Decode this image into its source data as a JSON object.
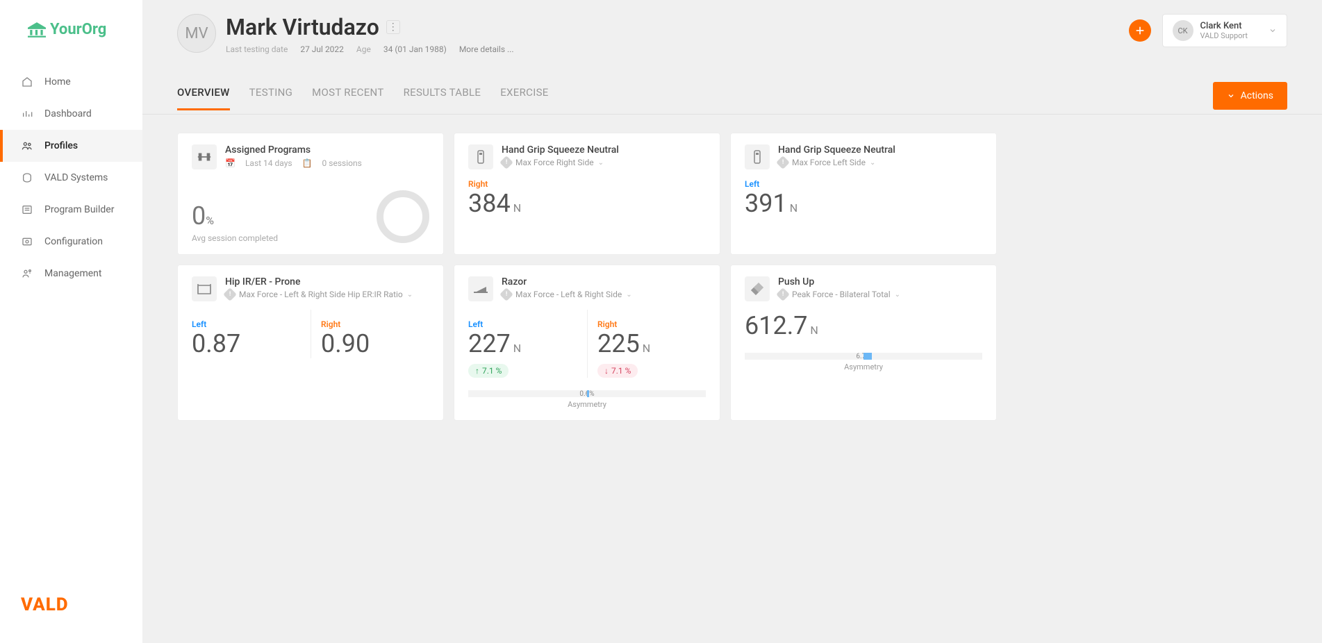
{
  "brand": {
    "name": "YourOrg",
    "footer": "VALD"
  },
  "nav": {
    "home": "Home",
    "dashboard": "Dashboard",
    "profiles": "Profiles",
    "vald_systems": "VALD Systems",
    "program_builder": "Program Builder",
    "configuration": "Configuration",
    "management": "Management"
  },
  "profile": {
    "initials": "MV",
    "name": "Mark Virtudazo",
    "last_testing_label": "Last testing date",
    "last_testing_value": "27 Jul 2022",
    "age_label": "Age",
    "age_value": "34 (01 Jan 1988)",
    "more_details": "More details ..."
  },
  "user": {
    "initials": "CK",
    "name": "Clark Kent",
    "role": "VALD Support"
  },
  "tabs": {
    "overview": "OVERVIEW",
    "testing": "TESTING",
    "most_recent": "MOST RECENT",
    "results_table": "RESULTS TABLE",
    "exercise": "EXERCISE"
  },
  "actions_label": "Actions",
  "cards": {
    "assigned": {
      "title": "Assigned Programs",
      "period": "Last 14 days",
      "sessions": "0 sessions",
      "pct": "0",
      "pct_unit": "%",
      "caption": "Avg session completed"
    },
    "grip_right": {
      "title": "Hand Grip Squeeze Neutral",
      "metric": "Max Force Right Side",
      "side": "Right",
      "value": "384",
      "unit": "N"
    },
    "grip_left": {
      "title": "Hand Grip Squeeze Neutral",
      "metric": "Max Force Left Side",
      "side": "Left",
      "value": "391",
      "unit": "N"
    },
    "hip": {
      "title": "Hip IR/ER - Prone",
      "metric": "Max Force - Left & Right Side Hip ER:IR Ratio",
      "left_label": "Left",
      "left_value": "0.87",
      "right_label": "Right",
      "right_value": "0.90"
    },
    "razor": {
      "title": "Razor",
      "metric": "Max Force - Left & Right Side",
      "left_label": "Left",
      "left_value": "227",
      "left_unit": "N",
      "left_delta": "7.1 %",
      "right_label": "Right",
      "right_value": "225",
      "right_unit": "N",
      "right_delta": "7.1 %",
      "asym_pct": "0.6%",
      "asym_label": "Asymmetry"
    },
    "pushup": {
      "title": "Push Up",
      "metric": "Peak Force - Bilateral Total",
      "value": "612.7",
      "unit": "N",
      "asym_pct": "6.7%",
      "asym_label": "Asymmetry"
    }
  }
}
